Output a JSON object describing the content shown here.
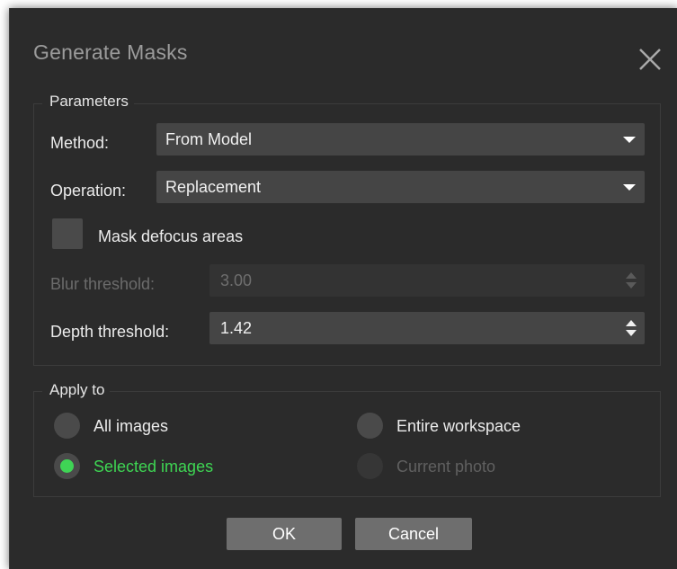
{
  "dialog": {
    "title": "Generate Masks",
    "close_icon": "close-icon"
  },
  "parameters": {
    "group_label": "Parameters",
    "method": {
      "label": "Method:",
      "value": "From Model"
    },
    "operation": {
      "label": "Operation:",
      "value": "Replacement"
    },
    "mask_defocus": {
      "label": "Mask defocus areas",
      "checked": false
    },
    "blur_threshold": {
      "label": "Blur threshold:",
      "value": "3.00",
      "enabled": false
    },
    "depth_threshold": {
      "label": "Depth threshold:",
      "value": "1.42",
      "enabled": true
    }
  },
  "apply_to": {
    "group_label": "Apply to",
    "options": {
      "all_images": {
        "label": "All images",
        "selected": false,
        "enabled": true
      },
      "entire_workspace": {
        "label": "Entire workspace",
        "selected": false,
        "enabled": true
      },
      "selected_images": {
        "label": "Selected images",
        "selected": true,
        "enabled": true
      },
      "current_photo": {
        "label": "Current photo",
        "selected": false,
        "enabled": false
      }
    }
  },
  "buttons": {
    "ok": "OK",
    "cancel": "Cancel"
  },
  "colors": {
    "background": "#2b2b2b",
    "accent_selected": "#3fd455",
    "control": "#454545",
    "button": "#6e6e6e"
  }
}
